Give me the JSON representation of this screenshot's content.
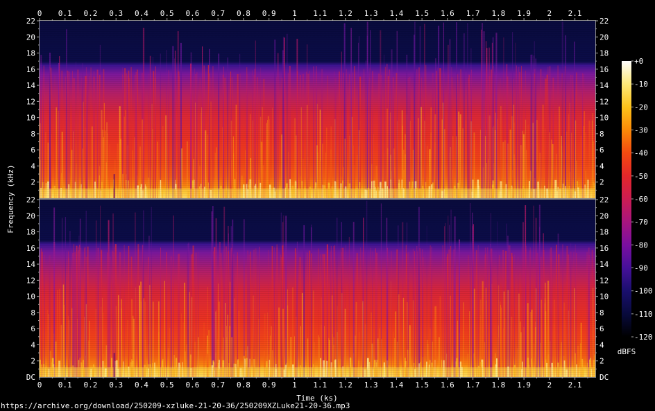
{
  "chart_data": {
    "type": "heatmap",
    "subtype": "spectrogram",
    "channels": 2,
    "xlabel": "Time (ks)",
    "ylabel": "Frequency (kHz)",
    "x_ticks": [
      "0",
      "0.1",
      "0.2",
      "0.3",
      "0.4",
      "0.5",
      "0.6",
      "0.7",
      "0.8",
      "0.9",
      "1",
      "1.1",
      "1.2",
      "1.3",
      "1.4",
      "1.5",
      "1.6",
      "1.7",
      "1.8",
      "1.9",
      "2",
      "2.1"
    ],
    "xlim": [
      0,
      2.18
    ],
    "y_ticks": [
      "2",
      "4",
      "6",
      "8",
      "10",
      "12",
      "14",
      "16",
      "18",
      "20",
      "22"
    ],
    "bottom_tick": "DC",
    "ylim": [
      0,
      22
    ],
    "lowpass_cutoff_khz": 16.5,
    "colorbar": {
      "label": "dBFS",
      "ticks": [
        "+0",
        "-10",
        "-20",
        "-30",
        "-40",
        "-50",
        "-60",
        "-70",
        "-80",
        "-90",
        "-100",
        "-110",
        "-120"
      ],
      "range": [
        -120,
        0
      ],
      "colors": [
        "#000000",
        "#080a3c",
        "#1a0f6e",
        "#46109a",
        "#7a0fa0",
        "#a8157e",
        "#cc1d52",
        "#e4272a",
        "#f44a10",
        "#fb8a08",
        "#fdc21a",
        "#fee97a",
        "#ffffff"
      ]
    }
  },
  "footer": {
    "url": "https://archive.org/download/250209-xzluke-21-20-36/250209XZLuke21-20-36.mp3"
  }
}
